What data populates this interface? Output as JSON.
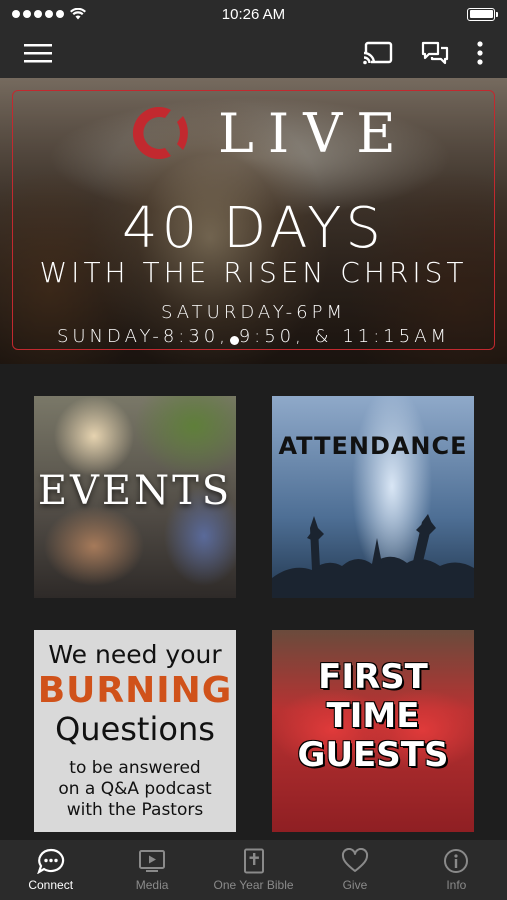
{
  "status_bar": {
    "time": "10:26 AM"
  },
  "app_bar": {
    "menu_icon": "hamburger-menu-icon",
    "cast_icon": "cast-icon",
    "chat_icon": "chat-bubbles-icon",
    "more_icon": "more-vertical-icon"
  },
  "hero": {
    "live_label": "LIVE",
    "title": "40 DAYS",
    "subtitle": "WITH THE RISEN CHRIST",
    "time_line_1": "SATURDAY-6PM",
    "time_line_2": "SUNDAY-8:30, 9:50, & 11:15AM",
    "accent_color": "#c2292f"
  },
  "tiles": {
    "events": {
      "label": "EVENTS"
    },
    "attendance": {
      "label": "ATTENDANCE"
    },
    "burning_questions": {
      "line1": "We need your",
      "line2": "BURNING",
      "line3": "Questions",
      "line4a": "to be answered",
      "line4b": "on a Q&A podcast",
      "line4c": "with the Pastors"
    },
    "first_time_guests": {
      "line1": "FIRST",
      "line2": "TIME",
      "line3": "GUESTS"
    }
  },
  "tab_bar": {
    "tabs": [
      {
        "label": "Connect",
        "icon": "chat-bubble-icon",
        "active": true
      },
      {
        "label": "Media",
        "icon": "play-screen-icon",
        "active": false
      },
      {
        "label": "One Year Bible",
        "icon": "bible-icon",
        "active": false
      },
      {
        "label": "Give",
        "icon": "heart-icon",
        "active": false
      },
      {
        "label": "Info",
        "icon": "info-icon",
        "active": false
      }
    ]
  }
}
